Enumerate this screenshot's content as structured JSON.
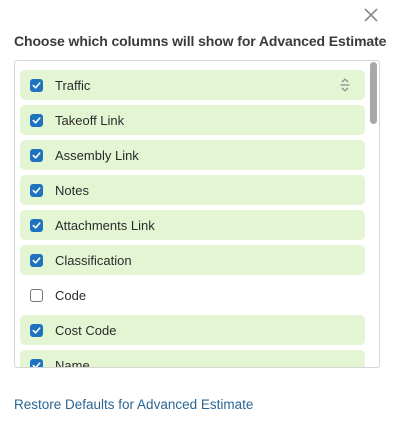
{
  "dialog": {
    "title": "Choose which columns will show for Advanced Estimate",
    "close_icon": "close-icon",
    "restore_link": "Restore Defaults for Advanced Estimate"
  },
  "columns": [
    {
      "label": "Traffic",
      "checked": true,
      "draggable": true
    },
    {
      "label": "Takeoff Link",
      "checked": true
    },
    {
      "label": "Assembly Link",
      "checked": true
    },
    {
      "label": "Notes",
      "checked": true
    },
    {
      "label": "Attachments Link",
      "checked": true
    },
    {
      "label": "Classification",
      "checked": true
    },
    {
      "label": "Code",
      "checked": false
    },
    {
      "label": "Cost Code",
      "checked": true
    },
    {
      "label": "Name",
      "checked": true
    }
  ],
  "colors": {
    "checked_row_bg": "#e3f5d3",
    "checkbox_accent": "#1e73be",
    "link": "#2a6593"
  }
}
